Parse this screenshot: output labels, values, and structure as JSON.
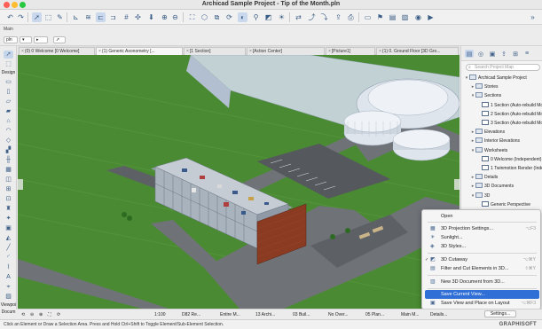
{
  "window": {
    "title": "Archicad Sample Project - Tip of the Month.pln"
  },
  "info": {
    "label": "Main"
  },
  "row2": {
    "pln_field": "pln",
    "arrow_field": "▸"
  },
  "tabs": [
    "(0) 0 Welcome [0 Welcome]",
    "(1) Generic Axonometry [...",
    "[1 Section]",
    "[Action Center]",
    "[Picture1]",
    "(1) 0. Ground Floor [3D Gro..."
  ],
  "toolbox": {
    "design_label": "Design",
    "viewpoint_label": "Viewpoi",
    "document_label": "Docum"
  },
  "navigator": {
    "search_placeholder": "Search Project Map",
    "tree": [
      {
        "label": "Archicad Sample Project",
        "level": 0,
        "chev": "▾",
        "folder": true
      },
      {
        "label": "Stories",
        "level": 1,
        "chev": "▸",
        "folder": true
      },
      {
        "label": "Sections",
        "level": 1,
        "chev": "▾",
        "folder": true
      },
      {
        "label": "1 Section (Auto-rebuild Mod",
        "level": 2,
        "chev": "",
        "folder": false
      },
      {
        "label": "2 Section (Auto-rebuild Mod",
        "level": 2,
        "chev": "",
        "folder": false
      },
      {
        "label": "3 Section (Auto-rebuild Mod",
        "level": 2,
        "chev": "",
        "folder": false
      },
      {
        "label": "Elevations",
        "level": 1,
        "chev": "▸",
        "folder": true
      },
      {
        "label": "Interior Elevations",
        "level": 1,
        "chev": "▸",
        "folder": true
      },
      {
        "label": "Worksheets",
        "level": 1,
        "chev": "▾",
        "folder": true
      },
      {
        "label": "0 Welcome (Independent)",
        "level": 2,
        "chev": "",
        "folder": false
      },
      {
        "label": "1 Twinmotion Render (Indep",
        "level": 2,
        "chev": "",
        "folder": false
      },
      {
        "label": "Details",
        "level": 1,
        "chev": "▸",
        "folder": true
      },
      {
        "label": "3D Documents",
        "level": 1,
        "chev": "▸",
        "folder": true
      },
      {
        "label": "3D",
        "level": 1,
        "chev": "▾",
        "folder": true
      },
      {
        "label": "Generic Perspective",
        "level": 2,
        "chev": "",
        "folder": false
      }
    ]
  },
  "context_menu": {
    "items": [
      {
        "label": "Open",
        "shortcut": "",
        "icon": "",
        "highlighted": false
      },
      {
        "label": "3D Projection Settings...",
        "shortcut": "⌥F3",
        "icon": "▦",
        "highlighted": false
      },
      {
        "label": "Sunlight...",
        "shortcut": "",
        "icon": "☀",
        "highlighted": false
      },
      {
        "label": "3D Styles...",
        "shortcut": "",
        "icon": "◈",
        "highlighted": false
      },
      {
        "label": "3D Cutaway",
        "shortcut": "⌥⌘Y",
        "icon": "◩",
        "highlighted": false,
        "checked": true
      },
      {
        "label": "Filter and Cut Elements in 3D...",
        "shortcut": "⇧⌘Y",
        "icon": "▤",
        "highlighted": false
      },
      {
        "label": "New 3D Document from 3D...",
        "shortcut": "",
        "icon": "▥",
        "highlighted": false
      },
      {
        "label": "Save Current View...",
        "shortcut": "",
        "icon": "",
        "highlighted": true
      },
      {
        "label": "Save View and Place on Layout",
        "shortcut": "⌥⌘F3",
        "icon": "▣",
        "highlighted": false
      }
    ]
  },
  "bottombar": {
    "items": [
      "1:100",
      "D82 Re...",
      "Entire M...",
      "13 Archi...",
      "03 Buil...",
      "No Over...",
      "05 Plan...",
      "Main M...",
      "Details..."
    ],
    "settings_label": "Settings..."
  },
  "status": {
    "hint": "Click an Element or Draw a Selection Area. Press and Hold Ctrl+Shift to Toggle Element/Sub-Element Selection.",
    "brand": "GRAPHISOFT"
  },
  "colors": {
    "grass": "#4a8a32",
    "road": "#6f7378",
    "accent": "#2f6fd6",
    "brick": "#8a3b22"
  }
}
